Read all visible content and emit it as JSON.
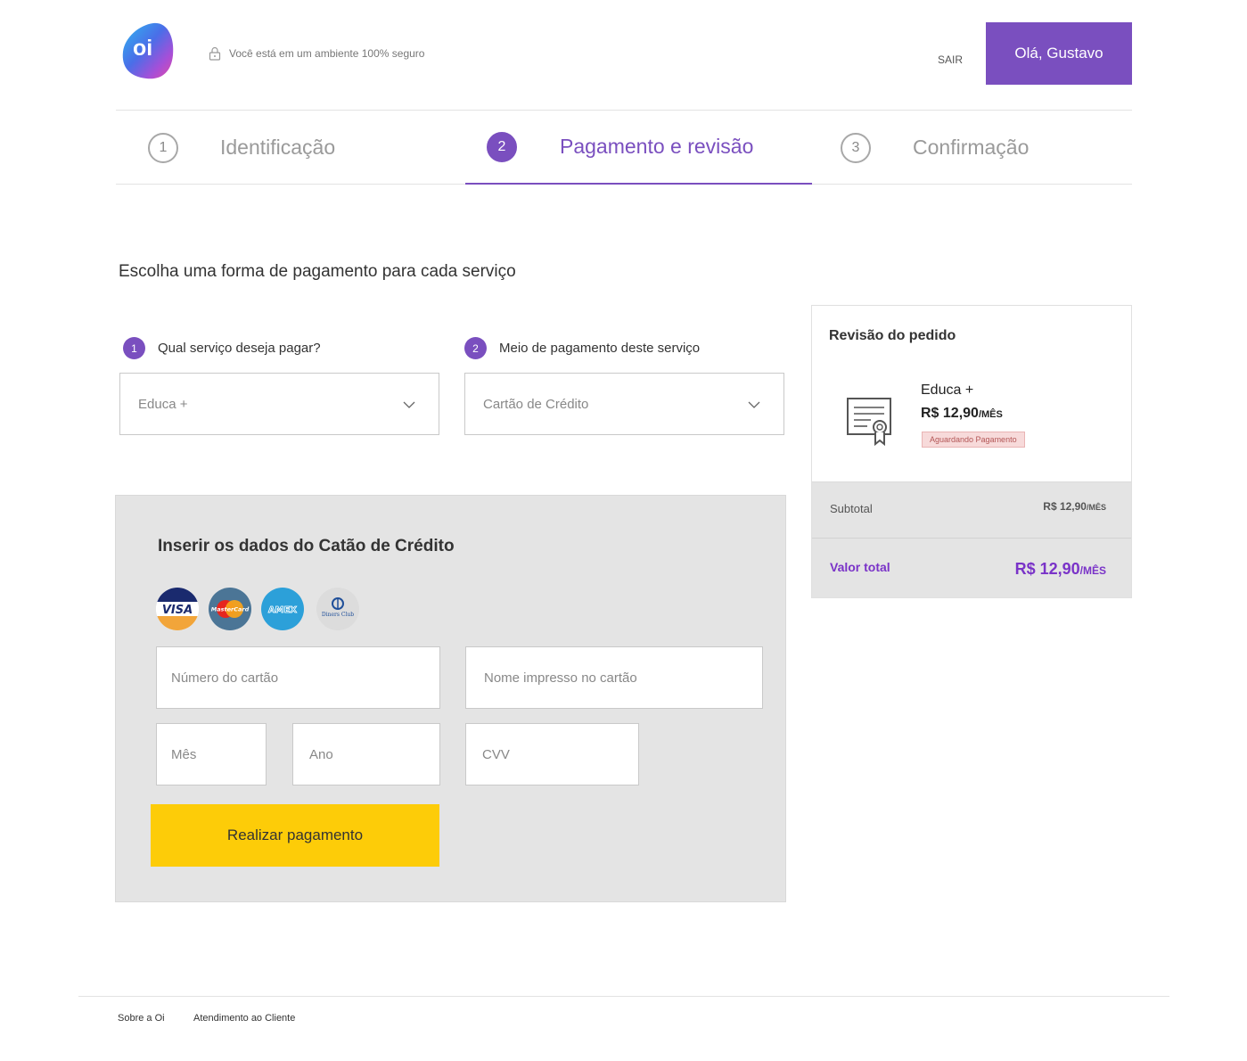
{
  "header": {
    "logo_text": "oi",
    "secure_text": "Você está em um ambiente 100% seguro",
    "logout_label": "SAIR",
    "user_greeting": "Olá, Gustavo"
  },
  "stepper": {
    "steps": [
      {
        "number": "1",
        "label": "Identificação",
        "state": "inactive"
      },
      {
        "number": "2",
        "label": "Pagamento e revisão",
        "state": "active"
      },
      {
        "number": "3",
        "label": "Confirmação",
        "state": "inactive"
      }
    ]
  },
  "main": {
    "title": "Escolha uma forma de pagamento para cada serviço",
    "question1": {
      "number": "1",
      "text": "Qual serviço deseja pagar?",
      "selected": "Educa +"
    },
    "question2": {
      "number": "2",
      "text": "Meio de pagamento deste serviço",
      "selected": "Cartão de Crédito"
    }
  },
  "card_form": {
    "title": "Inserir os dados do Catão de Crédito",
    "brands": [
      {
        "name": "VISA",
        "icon": "visa-icon"
      },
      {
        "name": "MasterCard",
        "icon": "mastercard-icon"
      },
      {
        "name": "AMEX",
        "icon": "amex-icon"
      },
      {
        "name": "Diners Club",
        "icon": "diners-club-icon"
      }
    ],
    "card_number_placeholder": "Número do cartão",
    "card_name_placeholder": "Nome impresso no cartão",
    "month_placeholder": "Mês",
    "year_placeholder": "Ano",
    "cvv_placeholder": "CVV",
    "submit_label": "Realizar pagamento"
  },
  "review": {
    "title": "Revisão do pedido",
    "item_name": "Educa +",
    "item_price": "R$ 12,90",
    "item_period": "/MÊS",
    "status": "Aguardando Pagamento",
    "subtotal_label": "Subtotal",
    "subtotal_value": "R$ 12,90",
    "subtotal_period": "/MÊS",
    "total_label": "Valor total",
    "total_value": "R$ 12,90",
    "total_period": "/MÊS"
  },
  "footer": {
    "links": [
      "Sobre a Oi",
      "Atendimento ao Cliente"
    ]
  },
  "colors": {
    "primary": "#7a4fbf",
    "accent_yellow": "#fdcc08",
    "panel_gray": "#e4e4e4",
    "total_purple": "#7a33c8",
    "status_bg": "#f7dada"
  }
}
